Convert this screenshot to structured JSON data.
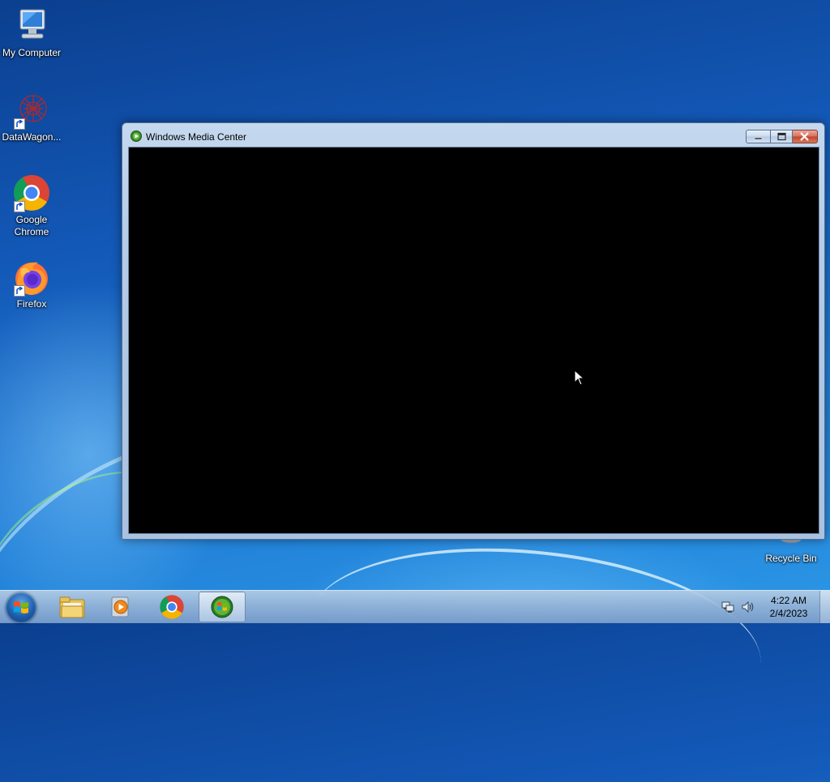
{
  "desktop": {
    "icons": [
      {
        "label": "My Computer",
        "icon": "my-computer-icon"
      },
      {
        "label": "DataWagon...",
        "icon": "datawagon-icon"
      },
      {
        "label": "Google Chrome",
        "icon": "chrome-icon"
      },
      {
        "label": "Firefox",
        "icon": "firefox-icon"
      }
    ],
    "recycle_bin": {
      "label": "Recycle Bin",
      "icon": "recycle-bin-icon"
    }
  },
  "window": {
    "title": "Windows Media Center",
    "icon": "media-center-icon",
    "buttons": {
      "minimize": "minimize-icon",
      "maximize": "maximize-icon",
      "close": "close-icon"
    }
  },
  "taskbar": {
    "start": "windows-logo-icon",
    "pinned": [
      {
        "name": "explorer",
        "icon": "folder-icon"
      },
      {
        "name": "media-player",
        "icon": "media-player-icon"
      },
      {
        "name": "chrome",
        "icon": "chrome-icon"
      },
      {
        "name": "media-center",
        "icon": "media-center-icon",
        "active": true
      }
    ],
    "tray": {
      "network": "network-icon",
      "volume": "speaker-icon"
    },
    "clock": {
      "time": "4:22 AM",
      "date": "2/4/2023"
    }
  },
  "colors": {
    "desktop": "#1a6bc7",
    "window_frame": "#b5cbe6",
    "client_area": "#000000",
    "close_button": "#c4432a"
  }
}
